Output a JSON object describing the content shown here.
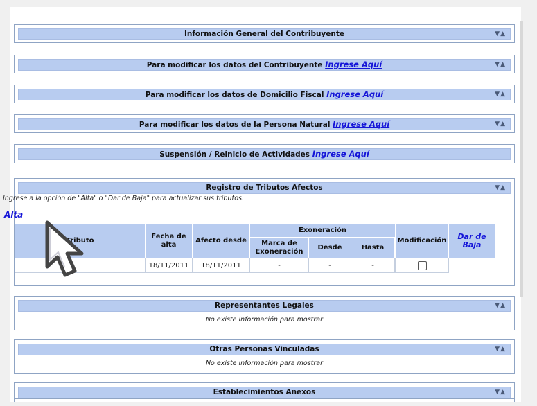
{
  "panels": {
    "general": {
      "title": "Información General del Contribuyente"
    },
    "mod_contrib": {
      "title": "Para modificar los datos del Contribuyente",
      "link": "Ingrese Aquí"
    },
    "mod_domicilio": {
      "title": "Para modificar los datos de Domicilio Fiscal",
      "link": "Ingrese Aquí"
    },
    "mod_persona": {
      "title": "Para modificar los datos de la Persona Natural",
      "link": "Ingrese Aquí"
    },
    "suspension": {
      "title": "Suspensión / Reinicio de Actividades",
      "link": "Ingrese Aquí"
    },
    "tributos": {
      "title": "Registro de Tributos Afectos"
    },
    "representantes": {
      "title": "Representantes Legales",
      "empty": "No existe información para mostrar"
    },
    "otras": {
      "title": "Otras Personas Vinculadas",
      "empty": "No existe información para mostrar"
    },
    "establecimientos": {
      "title": "Establecimientos Anexos"
    }
  },
  "arrows": "▼▲",
  "tributos": {
    "intro": "Ingrese a la opción de \"Alta\" o \"Dar de Baja\" para actualizar sus tributos.",
    "alta": "Alta",
    "headers": {
      "tributo": "Tributo",
      "fecha_alta": "Fecha de alta",
      "afecto_desde": "Afecto desde",
      "exoneracion": "Exoneración",
      "marca": "Marca de Exoneración",
      "desde": "Desde",
      "hasta": "Hasta",
      "modificacion": "Modificación",
      "dar_baja": "Dar de Baja"
    },
    "row": {
      "tributo": "",
      "fecha_alta": "18/11/2011",
      "afecto_desde": "18/11/2011",
      "marca": "-",
      "desde": "-",
      "hasta": "-",
      "modificacion": "",
      "dar_baja_checked": false
    }
  },
  "colors": {
    "header_bg": "#b8ccf0",
    "link": "#1515d8",
    "border": "#8fa4c4"
  }
}
